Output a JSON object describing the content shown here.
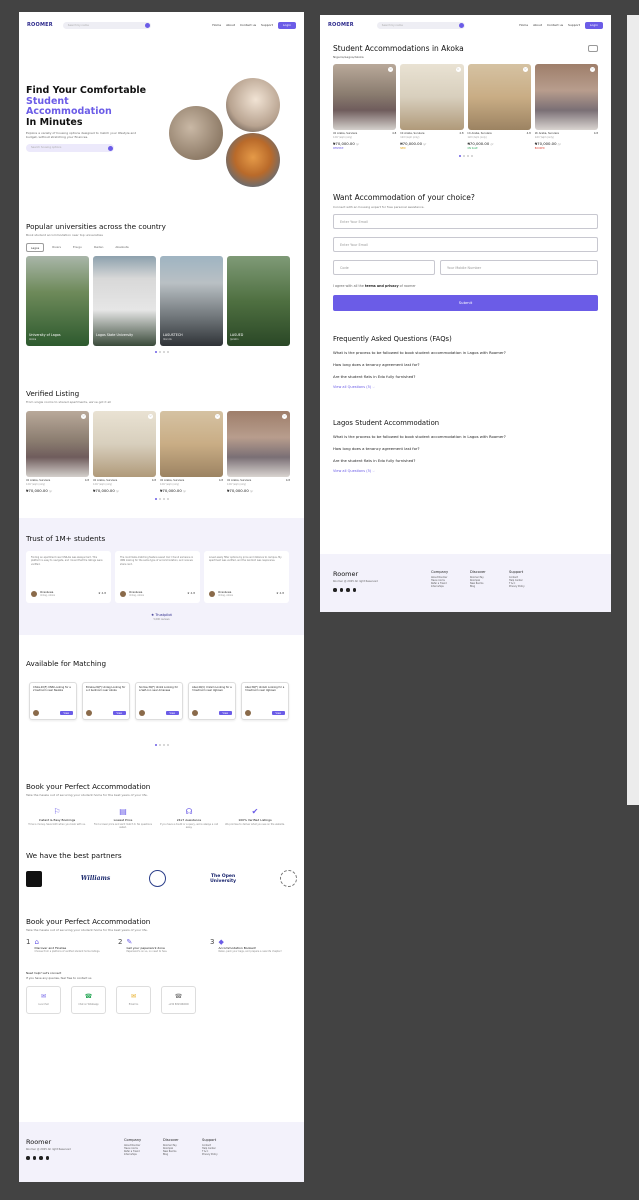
{
  "nav": {
    "logo": "ROOMER",
    "search_placeholder": "Search by name",
    "links": [
      "Home",
      "About",
      "Contact us",
      "Support"
    ],
    "login": "Login"
  },
  "hero": {
    "line1": "Find Your Comfortable",
    "line2": "Student Accommodation",
    "line3": "In Minutes",
    "desc": "Explore a variety of housing options designed to match your lifestyle and budget, without stretching your finances.",
    "search_placeholder": "Search housing options"
  },
  "universities": {
    "title": "Popular universities across the country",
    "subtitle": "Book student accommodation near top universities",
    "tabs": [
      "Lagos",
      "Rivers",
      "Enugu",
      "Ibadan",
      "Abeokuta"
    ],
    "cards": [
      {
        "name": "University of Lagos",
        "state": "Akoka"
      },
      {
        "name": "Lagos State University",
        "state": ""
      },
      {
        "name": "LASUSTECH",
        "state": "Ikorodu"
      },
      {
        "name": "LASUED",
        "state": "Ijanikin"
      }
    ]
  },
  "verified": {
    "title": "Verified Listing",
    "subtitle": "From single rooms to shared apartments, we've got it all",
    "items": [
      {
        "addr": "Idi Araba, Surulere",
        "rating": "4.8",
        "size": "12m²/sqm (only)",
        "price": "₦70,000.00",
        "per": "/yr"
      },
      {
        "addr": "Idi Araba, Surulere",
        "rating": "4.8",
        "size": "12m²/sqm (only)",
        "price": "₦70,000.00",
        "per": "/yr"
      },
      {
        "addr": "Idi Araba, Surulere",
        "rating": "4.8",
        "size": "12m²/sqm (only)",
        "price": "₦70,000.00",
        "per": "/yr"
      },
      {
        "addr": "Idi Araba, Surulere",
        "rating": "4.8",
        "size": "12m²/sqm (only)",
        "price": "₦70,000.00",
        "per": "/yr"
      }
    ]
  },
  "trust": {
    "title": "Trust of 1M+ students",
    "reviews": [
      {
        "quote": "Finding an apartment near UNILAG was always hard. This platform is easy to navigate, and I loved that the listings were verified.",
        "name": "Oraoluwa",
        "school": "Unilag, Akoka",
        "rating": "★ 4.8"
      },
      {
        "quote": "The roommate-matching feature saved me! I found someone in UNN looking for the same type of accommodation, and now we share rent.",
        "name": "Oraoluwa",
        "school": "Unilag, Akoka",
        "rating": "★ 4.8"
      },
      {
        "quote": "Loved easily filter options by price and distance to campus. My apartment was verified, and the landlord was responsive.",
        "name": "Oraoluwa",
        "school": "Unilag, Akoka",
        "rating": "★ 4.8"
      }
    ],
    "trustpilot": "★ Trustpilot",
    "reviews_count": "5,000 reviews"
  },
  "matching": {
    "title": "Available for Matching",
    "cards": [
      {
        "text": "Chika,20(F) UNN Looking for a 2 bedroom near Nsukka",
        "view": "View"
      },
      {
        "text": "Emeka,20(F) Unilag Looking for a 2 bedroom near Akoka",
        "view": "View"
      },
      {
        "text": "Sinmie,30(F) Unizik Looking for a Self-con near Amansea",
        "view": "View"
      },
      {
        "text": "Abel,40(C) Unilsm Looking for a 3 bedroom near Ugbowo",
        "view": "View"
      },
      {
        "text": "Abel,30(F) Unilsm Looking for a 3 bedroom near Ugbowo",
        "view": "View"
      }
    ]
  },
  "book": {
    "title": "Book your Perfect Accommodation",
    "subtitle": "Take the hassle out of securing your student home for the best years of your life.",
    "features": [
      {
        "title": "Instant & Easy Bookings",
        "desc": "Time is money. Save both when you book with us."
      },
      {
        "title": "Lowest Price",
        "desc": "Find a lower price and we'll match it. No questions asked."
      },
      {
        "title": "24x7 Assistance",
        "desc": "If you have a doubt or a query, we're always a call away."
      },
      {
        "title": "100% Verified Listings",
        "desc": "We promise to deliver what you see on the website."
      }
    ]
  },
  "partners": {
    "title": "We have the best partners",
    "items": [
      "Williams",
      "The Open University"
    ]
  },
  "steps": {
    "title": "Book your Perfect Accommodation",
    "subtitle": "Take the hassle out of securing your student home for the best years of your life.",
    "items": [
      {
        "num": "1",
        "title": "Discover and Finalise",
        "desc": "Choose from a plethora of verified student home listings."
      },
      {
        "num": "2",
        "title": "Get your paperwork done",
        "desc": "Paperwork's on us, no need to fuss."
      },
      {
        "num": "3",
        "title": "Accommodation Booked!",
        "desc": "Relax, pack your bags, and prepare a new life chapter!"
      }
    ]
  },
  "contact": {
    "title": "Need help? Let's connect",
    "subtitle": "If you have any queries, feel free to contact us",
    "items": [
      "Live Chat",
      "Chat on Whatsapp",
      "Email Us",
      "+234 8093460000"
    ]
  },
  "footer": {
    "brand": "Roomer",
    "copyright": "Roomer @ 2025 All right Reserved",
    "cols": [
      {
        "head": "Company",
        "items": [
          "About Roomer",
          "Have rooms",
          "Refer a friend",
          "Internships"
        ]
      },
      {
        "head": "Discover",
        "items": [
          "Roomer Pay",
          "Roompal",
          "New Rooms",
          "Blog"
        ]
      },
      {
        "head": "Support",
        "items": [
          "Contact",
          "Help Center",
          "T & C",
          "Privacy Policy"
        ]
      }
    ]
  },
  "page2": {
    "akoka": {
      "title": "Student Accommodations in Akoka",
      "crumb": "Nigeria/Lagos/Akoka",
      "items": [
        {
          "addr": "Idi Araba, Surulere",
          "rating": "4.8",
          "size": "12m²/sqm (only)",
          "price": "₦70,000.00",
          "per": "/yr",
          "tag": "RESERVE",
          "tag_color": "#6b5ce7"
        },
        {
          "addr": "Idi Araba, Surulere",
          "rating": "4.8",
          "size": "12m²/sqm (only)",
          "price": "₦70,000.00",
          "per": "/yr",
          "tag": "NEW",
          "tag_color": "#e6a817"
        },
        {
          "addr": "Idi Araba, Surulere",
          "rating": "4.8",
          "size": "12m²/sqm (only)",
          "price": "₦70,000.00",
          "per": "/yr",
          "tag": "ON SALE",
          "tag_color": "#2eaa5c"
        },
        {
          "addr": "Idi Araba, Surulere",
          "rating": "4.8",
          "size": "12m²/sqm (only)",
          "price": "₦70,000.00",
          "per": "/yr",
          "tag": "BOOKED",
          "tag_color": "#e04a3c"
        }
      ]
    },
    "form": {
      "title": "Want Accommodation of your choice?",
      "subtitle": "Connect with an housing expert for free personal assistance.",
      "email1": "Enter Your Email",
      "email2": "Enter Your Email",
      "code": "Code",
      "mobile": "Your Mobile Number",
      "agree_pre": "I agree with all the ",
      "agree_link": "terms and privacy",
      "agree_post": " of roomer",
      "submit": "Submit"
    },
    "faq": {
      "title": "Frequently Asked Questions (FAQs)",
      "items": [
        "What is the process to be followed to book student accommodation in Lagos with Roomer?",
        "How long does a tenancy agreement last for?",
        "Are the student flats in Edo fully furnished?"
      ],
      "link": "View all Questions (5)  ⌵"
    },
    "lagos": {
      "title": "Lagos Student Accommodation",
      "items": [
        "What is the process to be followed to book student accommodation in Lagos with Roomer?",
        "How long does a tenancy agreement last for?",
        "Are the student flats in Edo fully furnished?"
      ],
      "link": "View all Questions (5)  ⌵"
    }
  }
}
